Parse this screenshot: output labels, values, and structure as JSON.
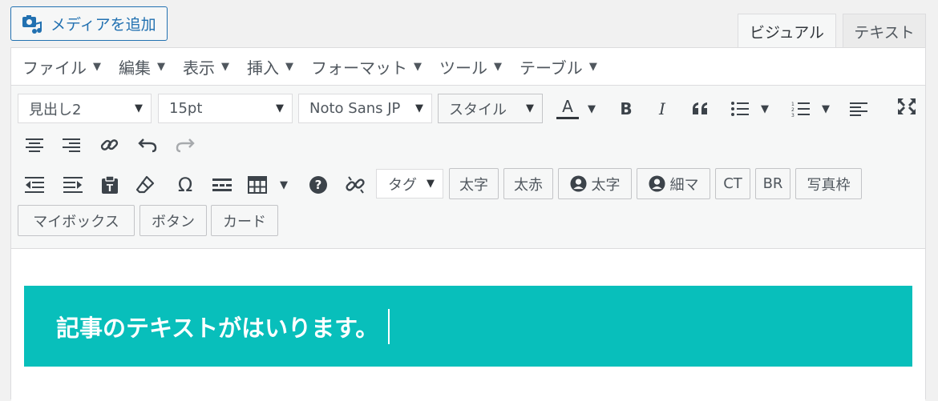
{
  "media_button": {
    "label": "メディアを追加",
    "icon": "camera-music-icon"
  },
  "tabs": [
    {
      "label": "ビジュアル",
      "active": true
    },
    {
      "label": "テキスト",
      "active": false
    }
  ],
  "menubar": [
    {
      "label": "ファイル"
    },
    {
      "label": "編集"
    },
    {
      "label": "表示"
    },
    {
      "label": "挿入"
    },
    {
      "label": "フォーマット"
    },
    {
      "label": "ツール"
    },
    {
      "label": "テーブル"
    }
  ],
  "toolbar": {
    "block_format": "見出し2",
    "font_size": "15pt",
    "font_family": "Noto Sans JP",
    "style_button": "スタイル",
    "text_color_letter": "A",
    "bold": "B",
    "italic": "I",
    "tag_select": "タグ",
    "omega": "Ω",
    "quicktags": [
      "太字",
      "太赤",
      "太字",
      "細マ",
      "CT",
      "BR",
      "写真枠",
      "マイボックス",
      "ボタン",
      "カード"
    ]
  },
  "content": {
    "heading_text": "記事のテキストがはいります。",
    "heading_bg": "#08bfbb"
  },
  "colors": {
    "accent": "#2271b1"
  }
}
